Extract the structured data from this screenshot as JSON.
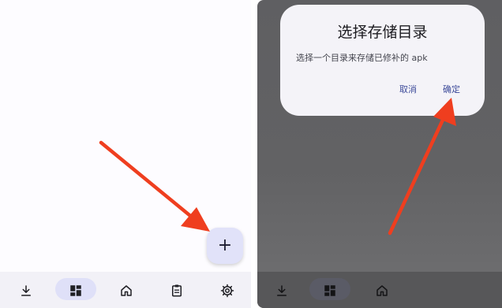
{
  "left_screen": {
    "fab": {
      "label": "+",
      "icon": "plus-icon"
    },
    "nav": {
      "items": [
        {
          "icon": "download-icon",
          "selected": false
        },
        {
          "icon": "dashboard-icon",
          "selected": true
        },
        {
          "icon": "home-icon",
          "selected": false
        },
        {
          "icon": "clipboard-icon",
          "selected": false
        },
        {
          "icon": "gear-icon",
          "selected": false
        }
      ]
    }
  },
  "right_screen": {
    "dialog": {
      "title": "选择存储目录",
      "message": "选择一个目录来存储已修补的 apk",
      "cancel_label": "取消",
      "confirm_label": "确定"
    },
    "nav": {
      "items": [
        {
          "icon": "download-icon",
          "selected": false
        },
        {
          "icon": "dashboard-icon",
          "selected": true
        },
        {
          "icon": "home-icon",
          "selected": false
        }
      ]
    }
  },
  "colors": {
    "annotation_arrow": "#ef3e1f",
    "fab_background": "#e1e2f9",
    "dialog_button_text": "#3d4b9a",
    "scrim": "#606062"
  }
}
